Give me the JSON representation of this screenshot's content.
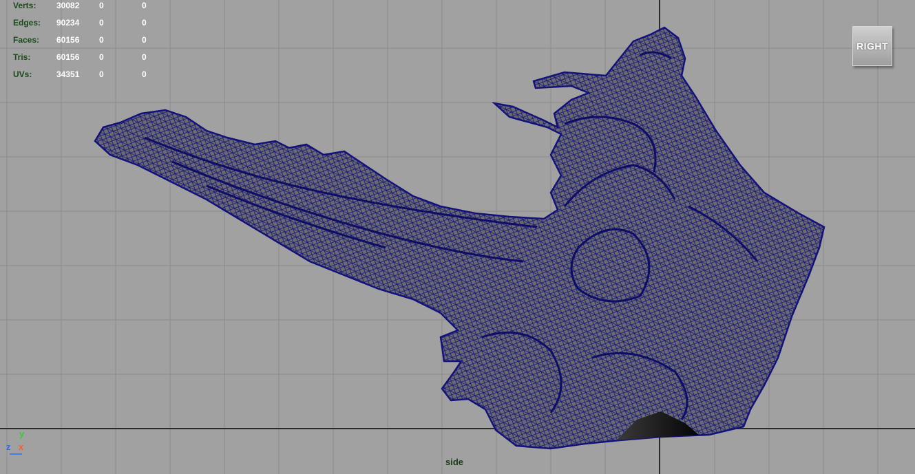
{
  "hud": {
    "rows": [
      {
        "label": "Verts:",
        "v1": "30082",
        "v2": "0",
        "v3": "0"
      },
      {
        "label": "Edges:",
        "v1": "90234",
        "v2": "0",
        "v3": "0"
      },
      {
        "label": "Faces:",
        "v1": "60156",
        "v2": "0",
        "v3": "0"
      },
      {
        "label": "Tris:",
        "v1": "60156",
        "v2": "0",
        "v3": "0"
      },
      {
        "label": "UVs:",
        "v1": "34351",
        "v2": "0",
        "v3": "0"
      }
    ]
  },
  "viewcube": {
    "label": "RIGHT"
  },
  "camera": {
    "name": "side"
  },
  "axis": {
    "y": "y",
    "z": "z",
    "x": "x"
  },
  "colors": {
    "background": "#a1a1a1",
    "grid": "#8e8e8e",
    "grid_axis": "#2b2b2b",
    "wireframe": "#14147a",
    "mesh_fill": "#6c6c70"
  }
}
